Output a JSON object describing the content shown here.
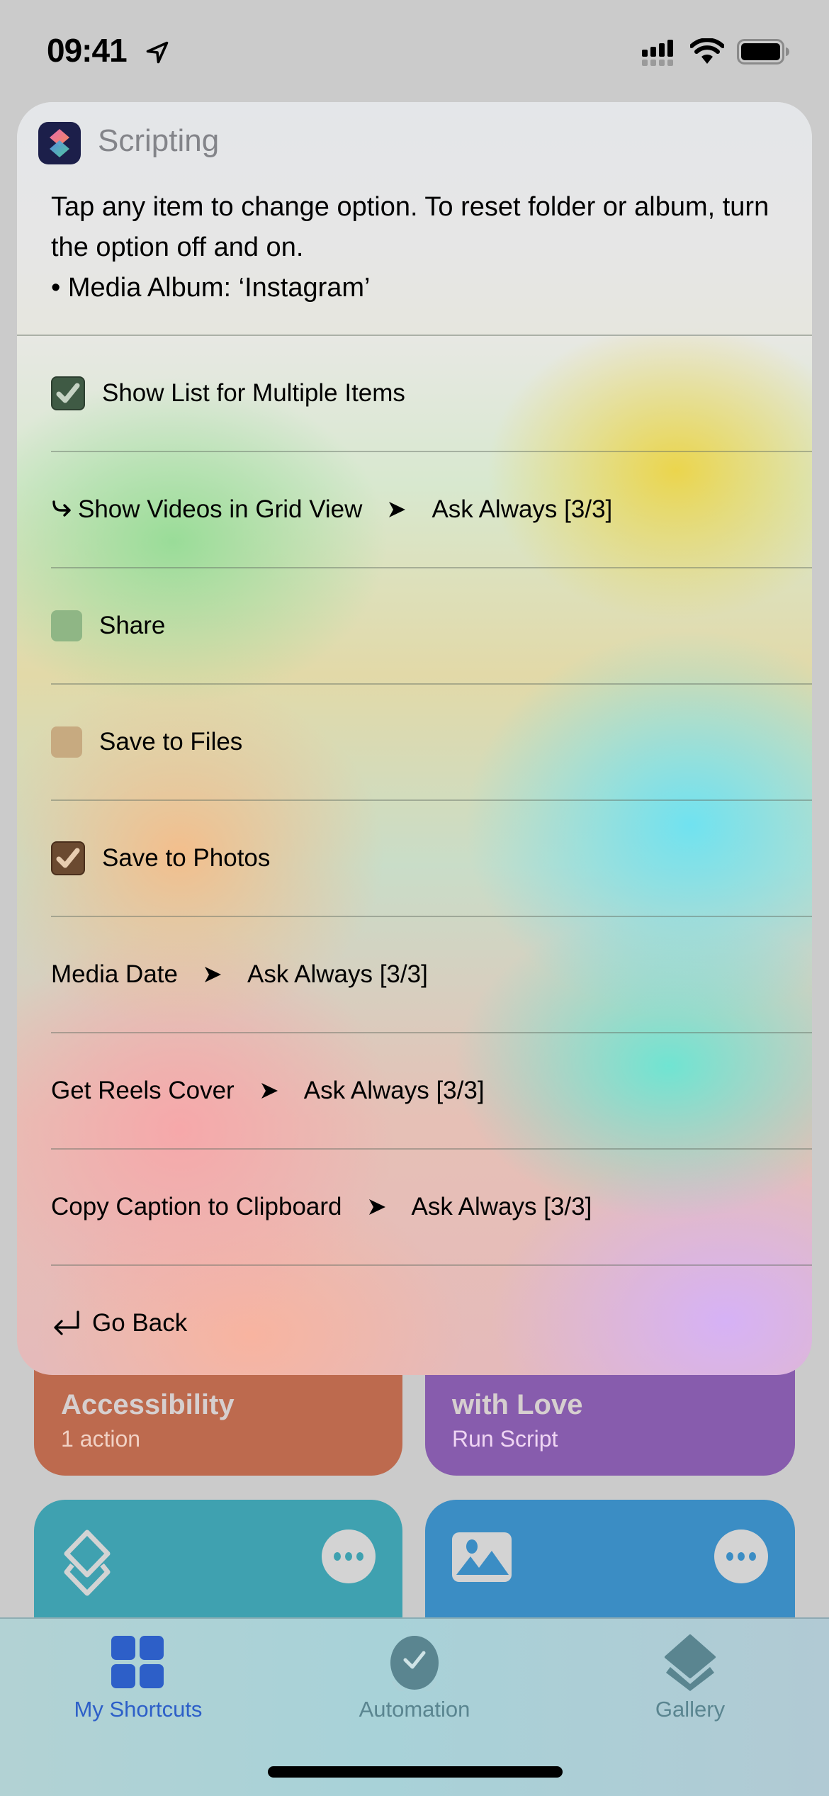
{
  "status_bar": {
    "time": "09:41",
    "icons": [
      "location-arrow-icon",
      "cellular-signal-icon",
      "wifi-icon",
      "battery-icon"
    ]
  },
  "dialog": {
    "app_name": "Scripting",
    "message_line1": "Tap any item to change option. To reset folder or album, turn the option off and on.",
    "message_line2": "• Media Album: ‘Instagram’",
    "items": [
      {
        "type": "checkbox",
        "label": "Show List for Multiple Items",
        "checked": true,
        "color": "#3f5a44"
      },
      {
        "type": "sub-option",
        "label": "Show Videos in Grid View",
        "value": "Ask Always [3/3]"
      },
      {
        "type": "checkbox",
        "label": "Share",
        "checked": false,
        "color": "#8fb685"
      },
      {
        "type": "checkbox",
        "label": "Save to Files",
        "checked": false,
        "color": "#c7aa80"
      },
      {
        "type": "checkbox",
        "label": "Save to Photos",
        "checked": true,
        "color": "#6b4a30"
      },
      {
        "type": "option",
        "label": "Media Date",
        "value": "Ask Always [3/3]"
      },
      {
        "type": "option",
        "label": "Get Reels Cover",
        "value": "Ask Always [3/3]"
      },
      {
        "type": "option",
        "label": "Copy Caption to Clipboard",
        "value": "Ask Always [3/3]"
      },
      {
        "type": "action",
        "label": "Go Back"
      }
    ]
  },
  "background_tiles": [
    {
      "title": "Accessibility",
      "subtitle": "1 action",
      "color": "#bd6a4e"
    },
    {
      "title": "with Love",
      "subtitle": "Run Script",
      "color": "#875cad"
    },
    {
      "icon": "layers-icon",
      "color": "#3fa1b0"
    },
    {
      "icon": "photo-icon",
      "color": "#3b8dc4"
    }
  ],
  "tab_bar": {
    "tabs": [
      {
        "label": "My Shortcuts",
        "active": true,
        "icon": "grid-icon"
      },
      {
        "label": "Automation",
        "active": false,
        "icon": "clock-check-icon"
      },
      {
        "label": "Gallery",
        "active": false,
        "icon": "layers-icon"
      }
    ],
    "active_color": "#2d5fc8",
    "inactive_color": "#5a8590"
  }
}
